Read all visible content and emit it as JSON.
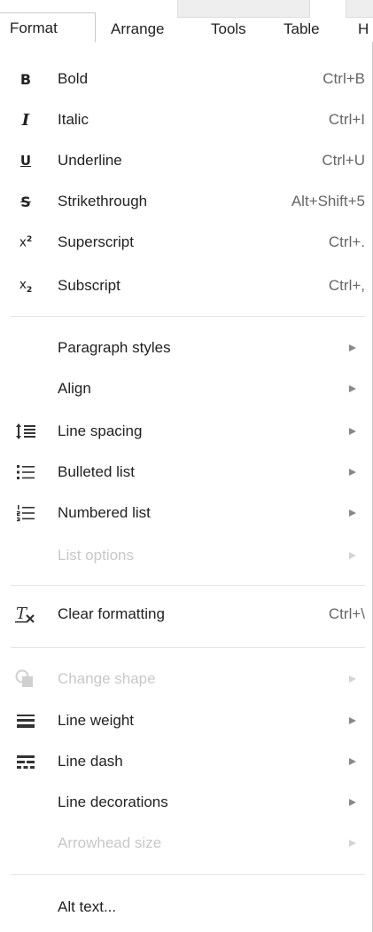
{
  "menubar": {
    "items": [
      {
        "label": "Format"
      },
      {
        "label": "Arrange"
      },
      {
        "label": "Tools"
      },
      {
        "label": "Table"
      },
      {
        "label": "H"
      }
    ]
  },
  "menu": {
    "bold": {
      "label": "Bold",
      "shortcut": "Ctrl+B",
      "icon": "bold-icon"
    },
    "italic": {
      "label": "Italic",
      "shortcut": "Ctrl+I",
      "icon": "italic-icon"
    },
    "underline": {
      "label": "Underline",
      "shortcut": "Ctrl+U",
      "icon": "underline-icon"
    },
    "strikethrough": {
      "label": "Strikethrough",
      "shortcut": "Alt+Shift+5",
      "icon": "strikethrough-icon"
    },
    "superscript": {
      "label": "Superscript",
      "shortcut": "Ctrl+.",
      "icon": "superscript-icon"
    },
    "subscript": {
      "label": "Subscript",
      "shortcut": "Ctrl+,",
      "icon": "subscript-icon"
    },
    "paragraph_styles": {
      "label": "Paragraph styles"
    },
    "align": {
      "label": "Align"
    },
    "line_spacing": {
      "label": "Line spacing",
      "icon": "line-spacing-icon"
    },
    "bulleted_list": {
      "label": "Bulleted list",
      "icon": "bulleted-list-icon"
    },
    "numbered_list": {
      "label": "Numbered list",
      "icon": "numbered-list-icon"
    },
    "list_options": {
      "label": "List options",
      "disabled": true
    },
    "clear_formatting": {
      "label": "Clear formatting",
      "shortcut": "Ctrl+\\",
      "icon": "clear-formatting-icon"
    },
    "change_shape": {
      "label": "Change shape",
      "disabled": true,
      "icon": "change-shape-icon"
    },
    "line_weight": {
      "label": "Line weight",
      "icon": "line-weight-icon"
    },
    "line_dash": {
      "label": "Line dash",
      "icon": "line-dash-icon"
    },
    "line_decorations": {
      "label": "Line decorations"
    },
    "arrowhead_size": {
      "label": "Arrowhead size",
      "disabled": true
    },
    "alt_text": {
      "label": "Alt text..."
    }
  },
  "colors": {
    "text": "#222222",
    "disabled_text": "#c8c8c8",
    "border": "#c8c8c8",
    "divider": "#e5e5e5"
  }
}
